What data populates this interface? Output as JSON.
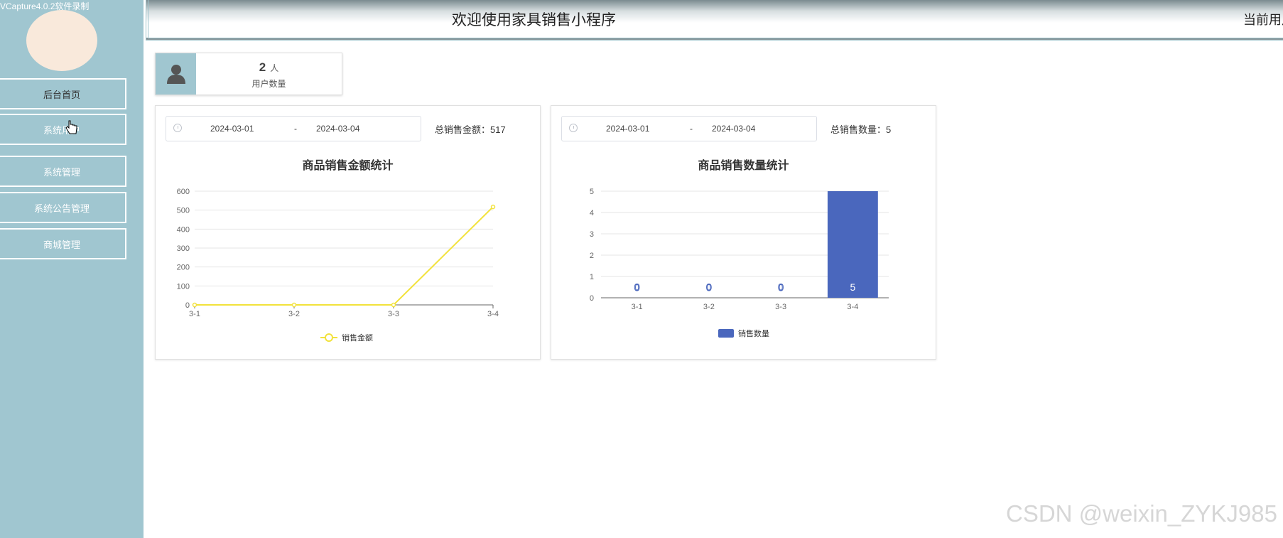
{
  "capture_watermark": "VCapture4.0.2软件录制",
  "header": {
    "app_title": "欢迎使用家具销售小程序",
    "current_user": "当前用户：admin"
  },
  "sidebar": {
    "items": [
      {
        "label": "后台首页"
      },
      {
        "label": "系统用户"
      },
      {
        "label": "系统管理"
      },
      {
        "label": "系统公告管理"
      },
      {
        "label": "商城管理"
      }
    ]
  },
  "stat_card": {
    "value": "2",
    "unit": "人",
    "label": "用户数量",
    "icon": "user-icon"
  },
  "amount_panel": {
    "date_start": "2024-03-01",
    "date_sep": "-",
    "date_end": "2024-03-04",
    "total": "总销售金额：517"
  },
  "quantity_panel": {
    "date_start": "2024-03-01",
    "date_sep": "-",
    "date_end": "2024-03-04",
    "total": "总销售数量：5"
  },
  "chart_data": [
    {
      "type": "line",
      "title": "商品销售金额统计",
      "categories": [
        "3-1",
        "3-2",
        "3-3",
        "3-4"
      ],
      "series": [
        {
          "name": "销售金额",
          "values": [
            0,
            0,
            0,
            517
          ],
          "color": "#f2e23c"
        }
      ],
      "y_ticks": [
        0,
        100,
        200,
        300,
        400,
        500,
        600
      ],
      "ylim": [
        0,
        600
      ],
      "grid": true,
      "legend": "bottom-center"
    },
    {
      "type": "bar",
      "title": "商品销售数量统计",
      "categories": [
        "3-1",
        "3-2",
        "3-3",
        "3-4"
      ],
      "series": [
        {
          "name": "销售数量",
          "values": [
            0,
            0,
            0,
            5
          ],
          "color": "#4a67bd"
        }
      ],
      "data_labels": [
        "0",
        "0",
        "0",
        "5"
      ],
      "y_ticks": [
        0,
        1,
        2,
        3,
        4,
        5
      ],
      "ylim": [
        0,
        5
      ],
      "grid": true,
      "legend": "bottom-center"
    }
  ],
  "csdn_watermark": "CSDN @weixin_ZYKJ985"
}
